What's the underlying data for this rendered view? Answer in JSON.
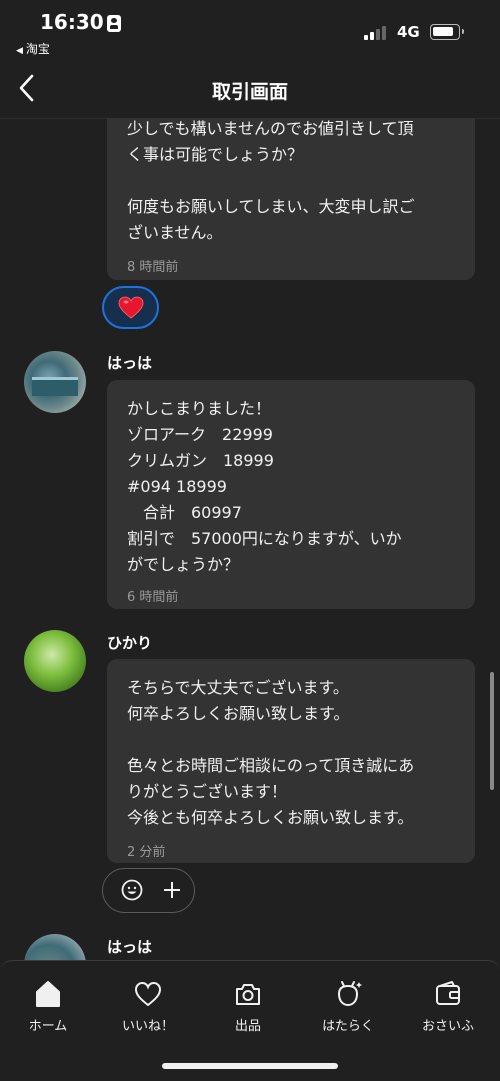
{
  "status_bar": {
    "time": "16:30",
    "back_app": "淘宝",
    "network": "4G"
  },
  "header": {
    "title": "取引画面"
  },
  "messages": [
    {
      "lines": [
        "少しでも構いませんのでお値引きして頂",
        "く事は可能でしょうか？",
        "",
        "何度もお願いしてしまい、大変申し訳ご",
        "ざいません。"
      ],
      "time": "8 時間前"
    },
    {
      "sender": "はっは",
      "lines": [
        "かしこまりました！",
        "ゾロアーク　22999",
        "クリムガン　18999",
        "#094 18999",
        "　合計　60997",
        "割引で　57000円になりますが、いか",
        "がでしょうか？"
      ],
      "time": "6 時間前"
    },
    {
      "sender": "ひかり",
      "lines": [
        "そちらで大丈夫でございます。",
        "何卒よろしくお願い致します。",
        "",
        "色々とお時間ご相談にのって頂き誠にあ",
        "りがとうございます！",
        "今後とも何卒よろしくお願い致します。"
      ],
      "time": "2 分前"
    },
    {
      "sender": "はっは"
    }
  ],
  "nav": [
    {
      "label": "ホーム",
      "icon": "home-icon"
    },
    {
      "label": "いいね！",
      "icon": "heart-icon"
    },
    {
      "label": "出品",
      "icon": "camera-icon"
    },
    {
      "label": "はたらく",
      "icon": "sparkle-bag-icon"
    },
    {
      "label": "おさいふ",
      "icon": "wallet-icon"
    }
  ],
  "colors": {
    "background": "#202020",
    "bubble": "#333334",
    "reaction_border": "#1e73e0",
    "heart": "#e8162c"
  }
}
